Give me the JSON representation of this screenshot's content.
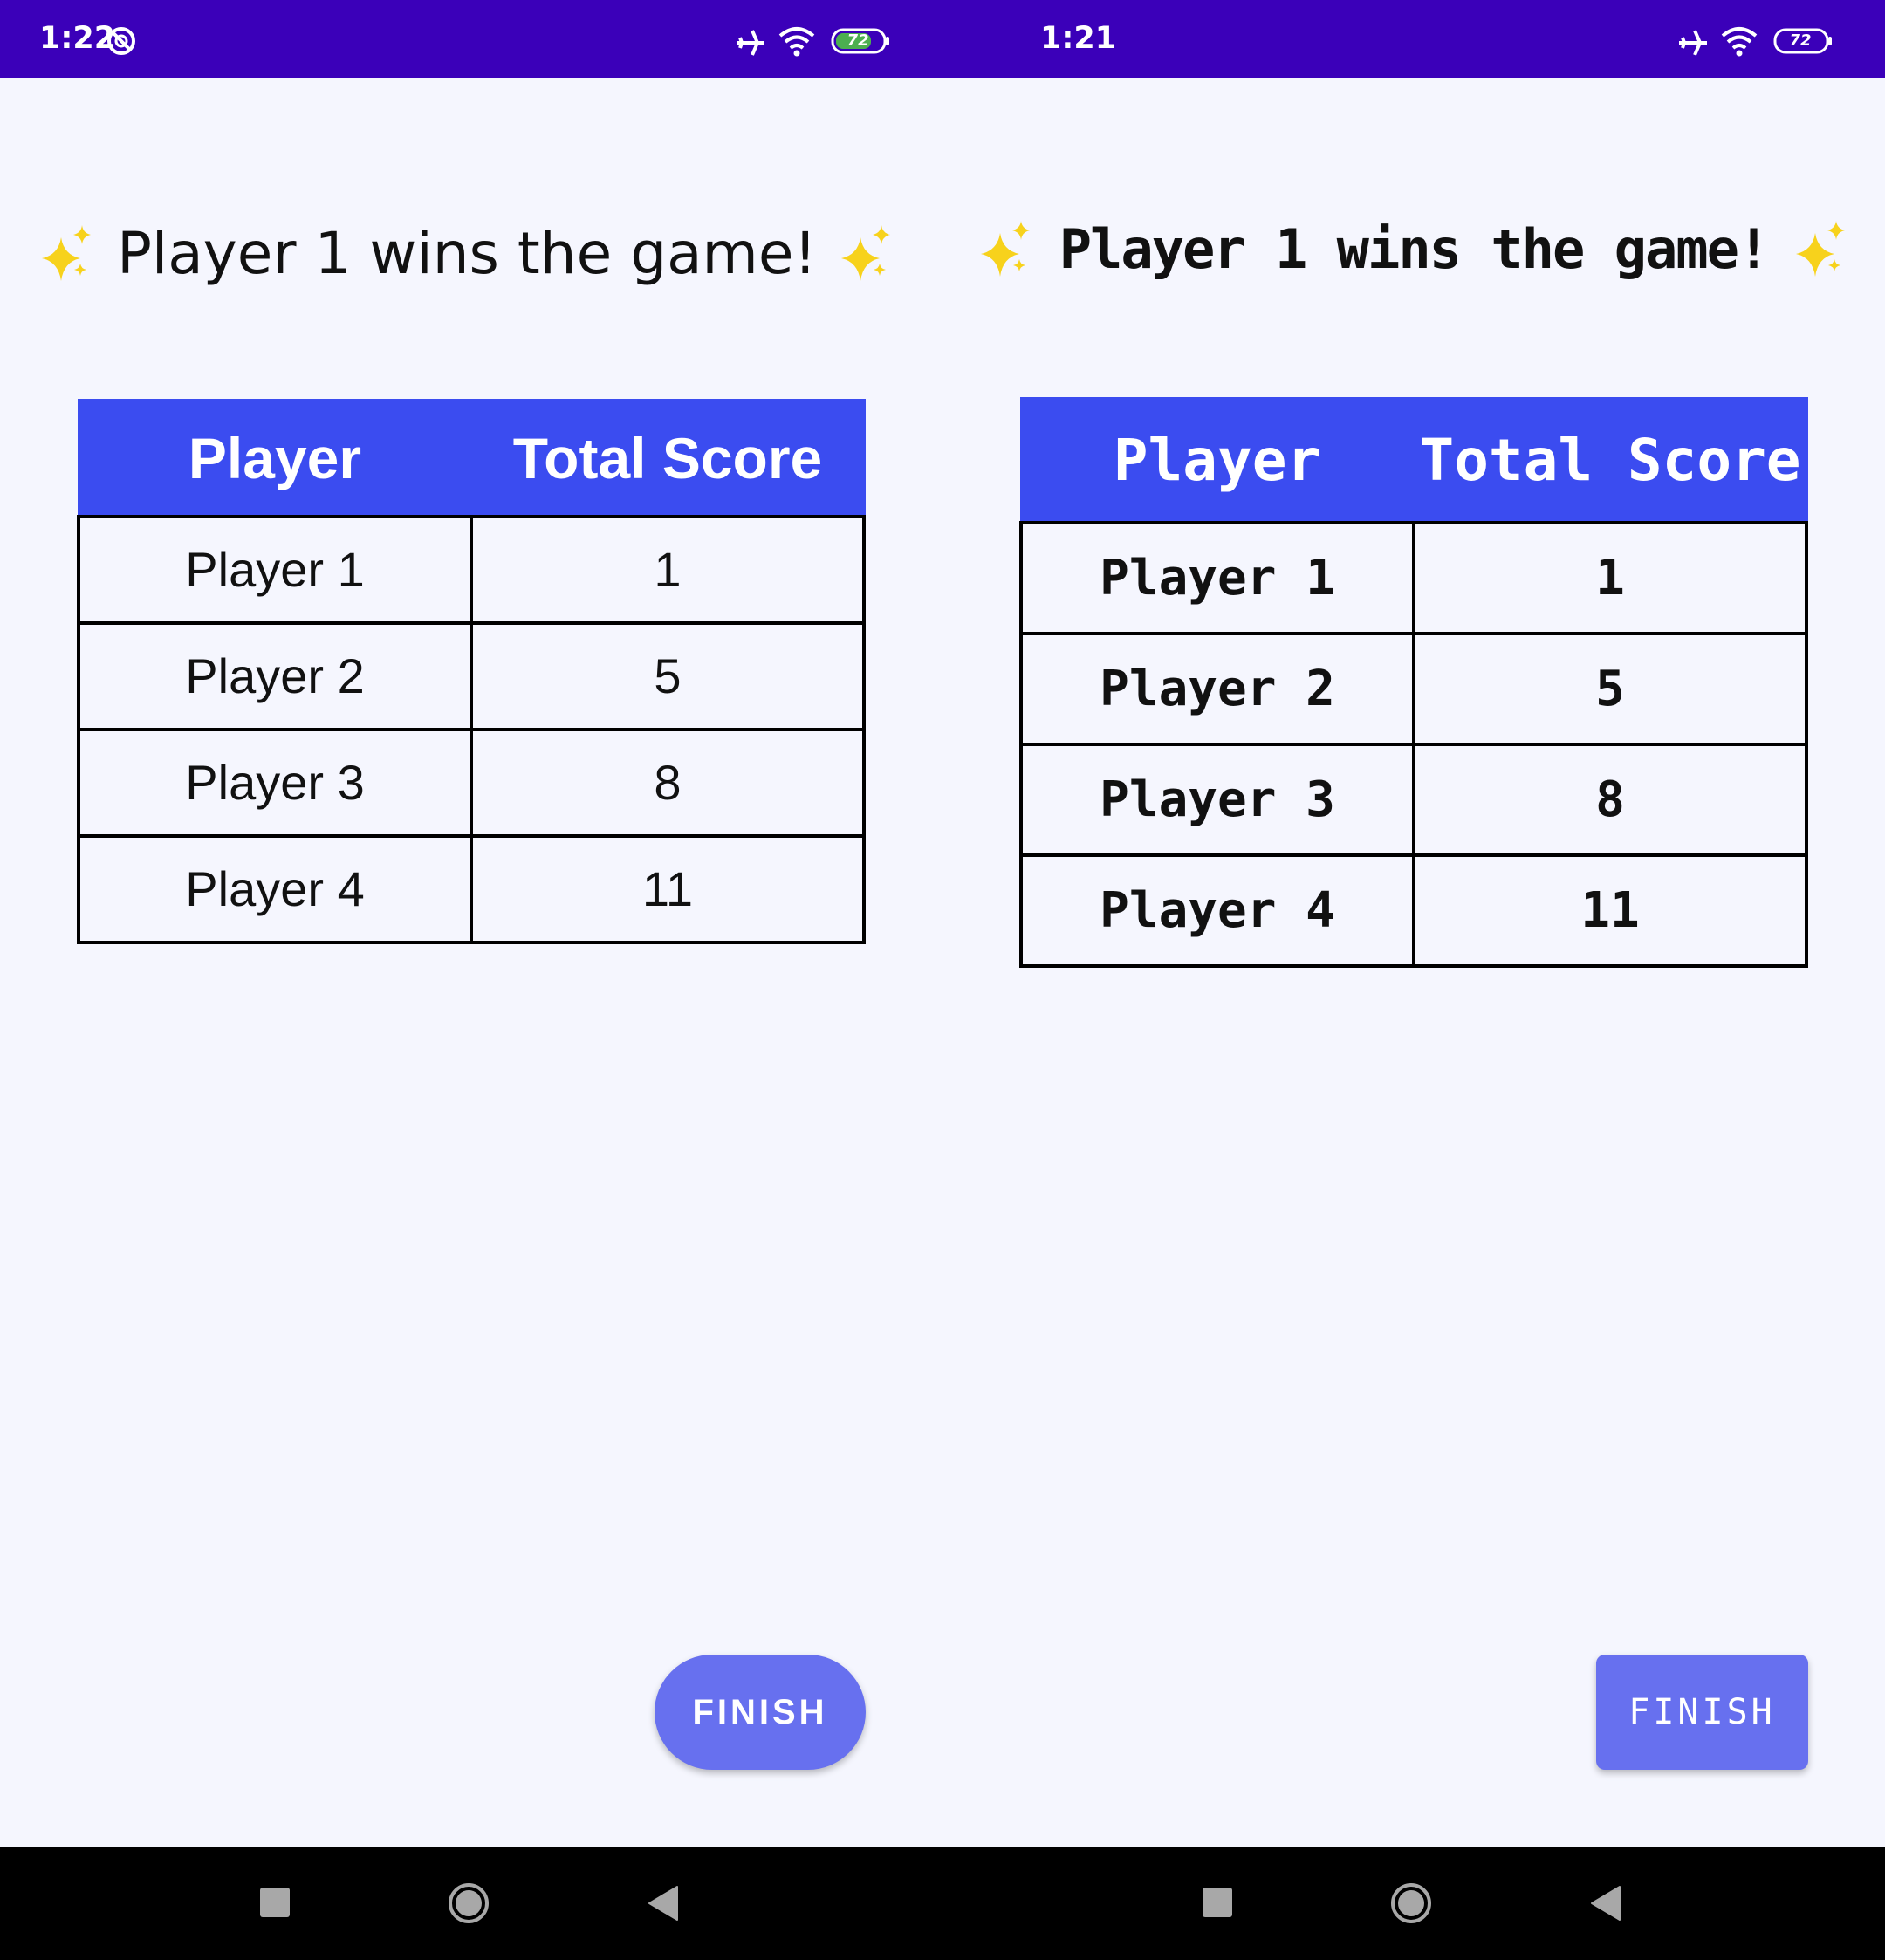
{
  "screens": [
    {
      "status_time": "1:22",
      "battery": "72",
      "title": "Player 1 wins the game!",
      "table": {
        "headers": [
          "Player",
          "Total Score"
        ],
        "rows": [
          [
            "Player 1",
            "1"
          ],
          [
            "Player 2",
            "5"
          ],
          [
            "Player 3",
            "8"
          ],
          [
            "Player 4",
            "11"
          ]
        ]
      },
      "finish_label": "FINISH"
    },
    {
      "status_time": "1:21",
      "battery": "72",
      "title": "Player 1 wins the game!",
      "table": {
        "headers": [
          "Player",
          "Total Score"
        ],
        "rows": [
          [
            "Player 1",
            "1"
          ],
          [
            "Player 2",
            "5"
          ],
          [
            "Player 3",
            "8"
          ],
          [
            "Player 4",
            "11"
          ]
        ]
      },
      "finish_label": "FINISH"
    }
  ],
  "icons": {
    "status": [
      "do-not-disturb-icon",
      "airplane-mode-icon",
      "wifi-icon",
      "battery-icon"
    ],
    "title": [
      "sparkles-icon"
    ],
    "nav": [
      "recents-icon",
      "home-icon",
      "back-icon"
    ]
  },
  "colors": {
    "status_bar": "#3b00b9",
    "table_header": "#3b4cf0",
    "finish_button": "#6770ef",
    "background": "#f5f6fe",
    "sparkle": "#f7d21c",
    "battery_left": "#4caf50",
    "battery_right": "#3b00b9"
  }
}
